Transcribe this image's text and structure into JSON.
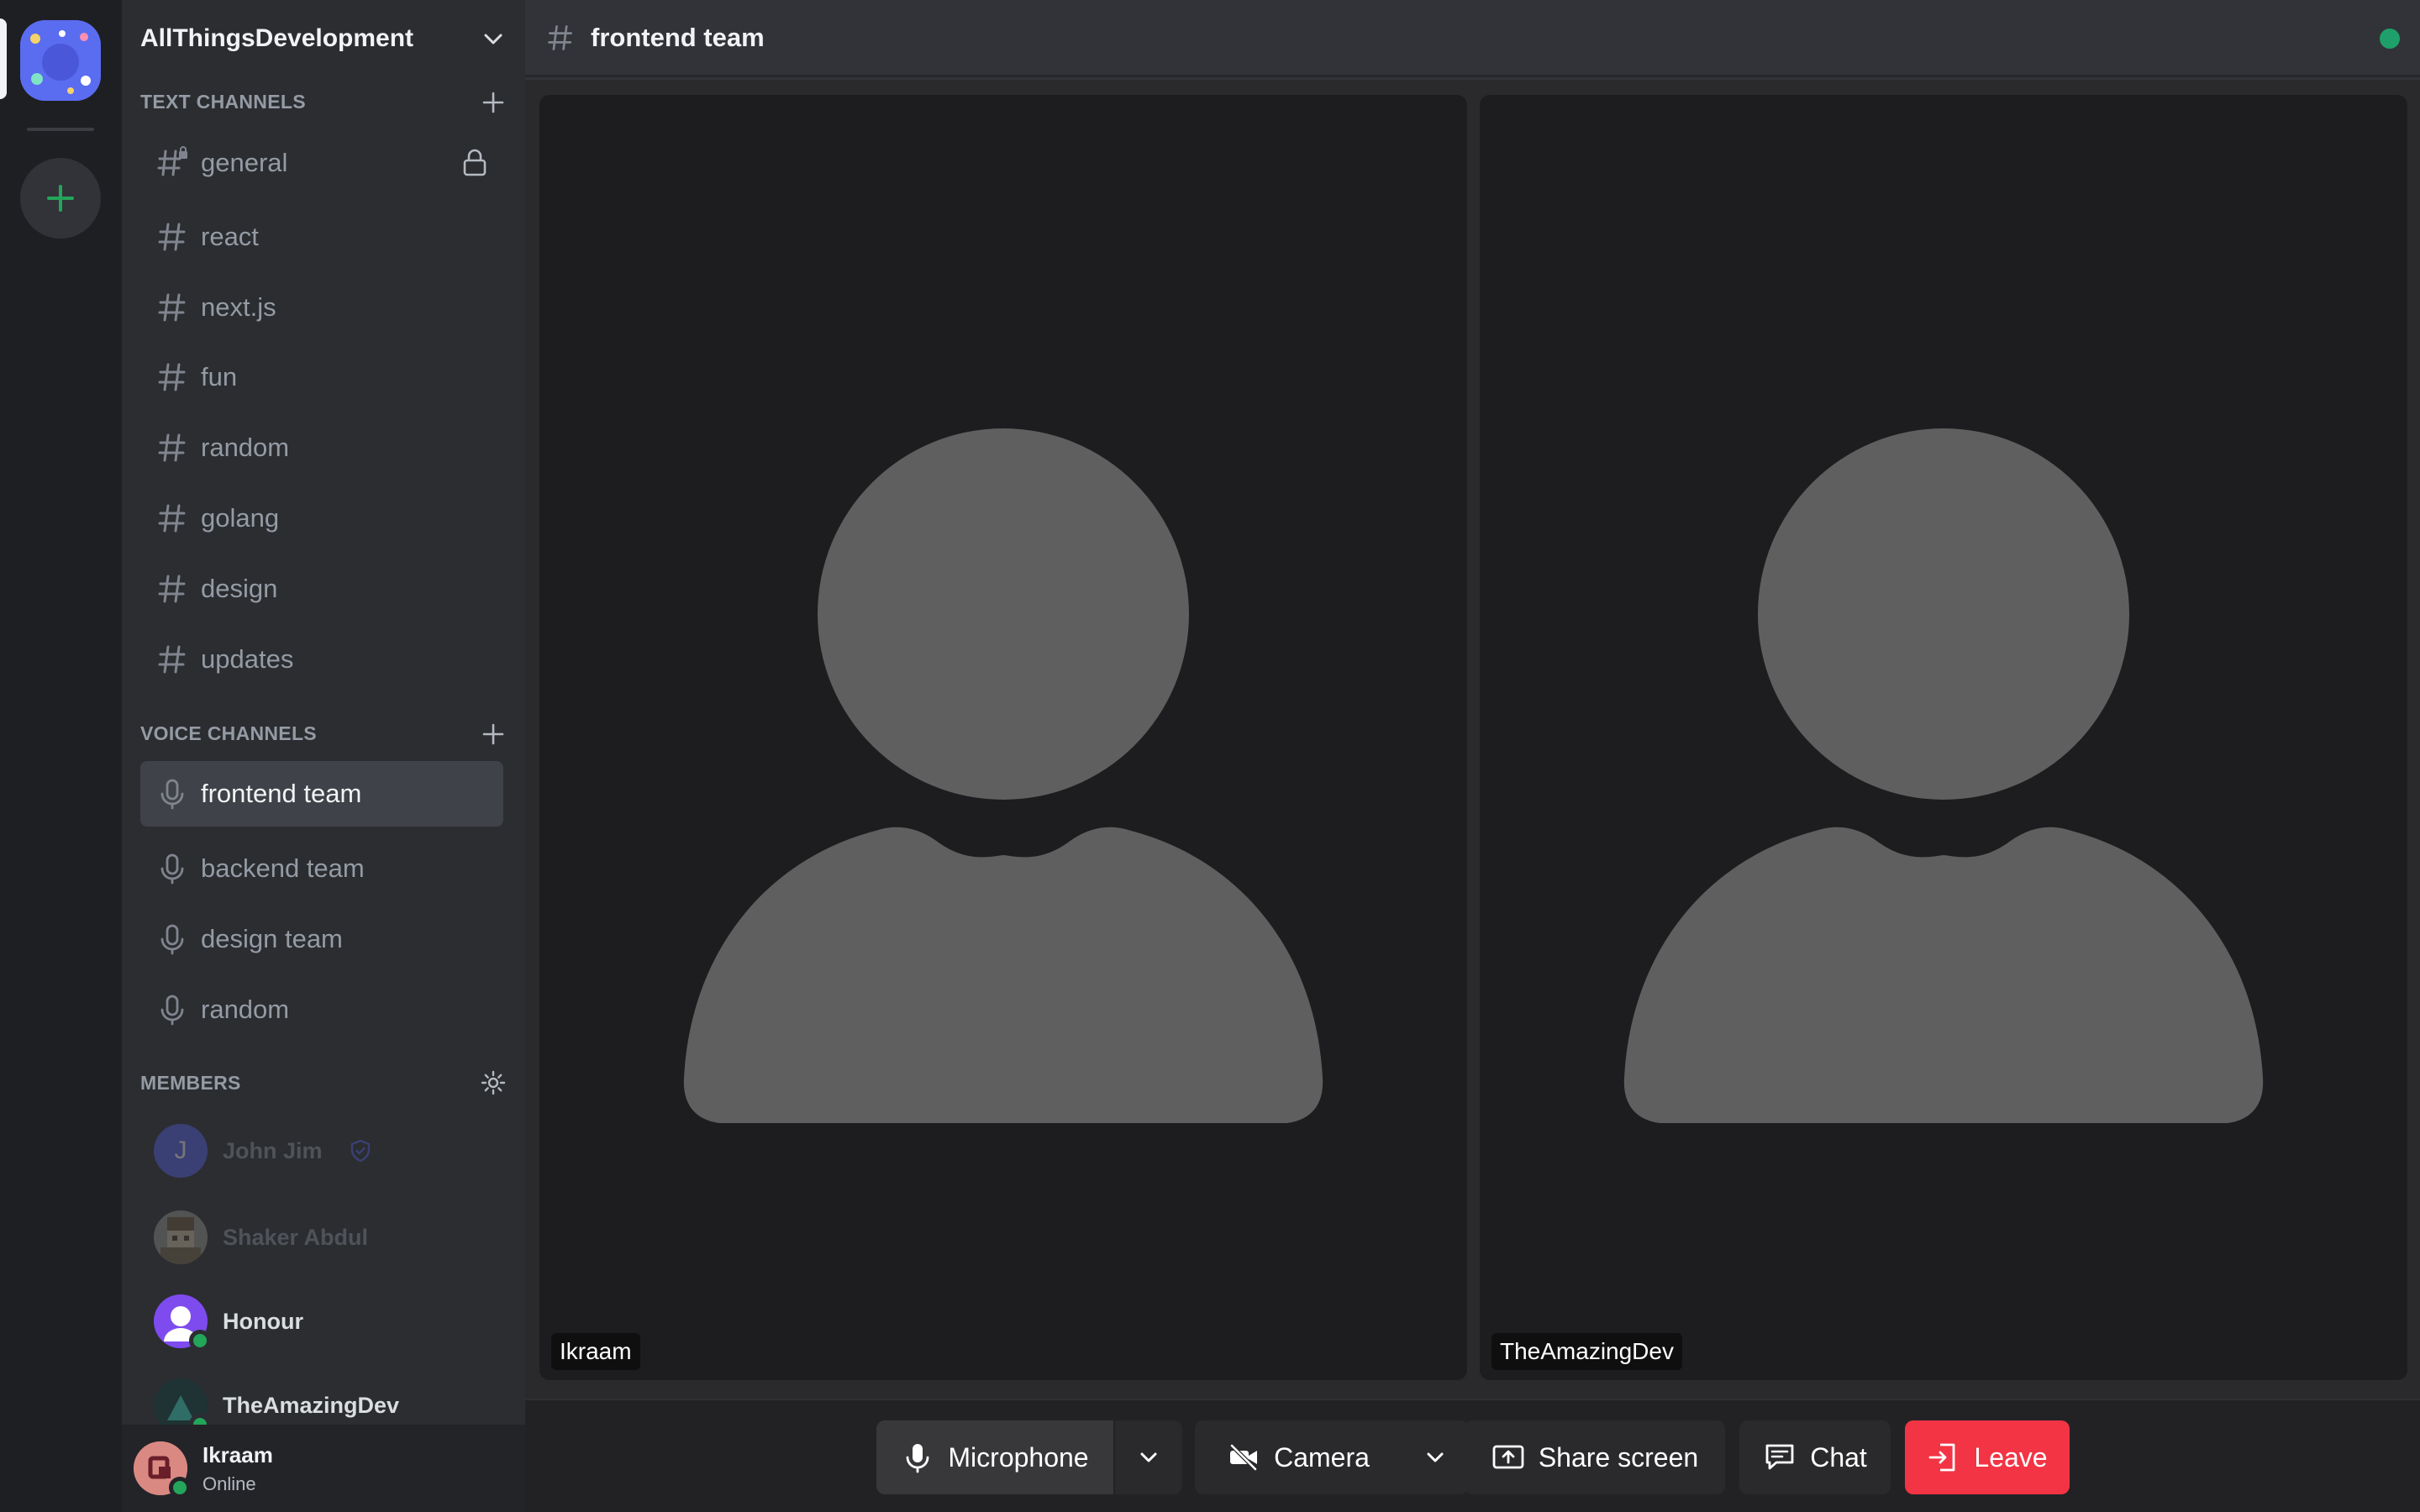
{
  "server": {
    "name": "AllThingsDevelopment"
  },
  "sidebar": {
    "text_header": "TEXT CHANNELS",
    "text_channels": [
      "general",
      "react",
      "next.js",
      "fun",
      "random",
      "golang",
      "design",
      "updates"
    ],
    "voice_header": "VOICE CHANNELS",
    "voice_channels": [
      "frontend team",
      "backend team",
      "design team",
      "random"
    ],
    "active_voice_channel": "frontend team",
    "members_header": "MEMBERS",
    "members": [
      {
        "name": "John Jim",
        "initial": "J",
        "online": false,
        "role_icon": "shield-icon"
      },
      {
        "name": "Shaker Abdul",
        "online": false
      },
      {
        "name": "Honour",
        "online": true
      },
      {
        "name": "TheAmazingDev",
        "online": true
      }
    ]
  },
  "user_panel": {
    "name": "Ikraam",
    "status": "Online"
  },
  "topbar": {
    "channel_name": "frontend team",
    "connection_color": "#1fa06a"
  },
  "participants": [
    {
      "name": "Ikraam"
    },
    {
      "name": "TheAmazingDev"
    }
  ],
  "controls": {
    "microphone": "Microphone",
    "camera": "Camera",
    "share_screen": "Share screen",
    "chat": "Chat",
    "leave": "Leave"
  },
  "colors": {
    "accent_green": "#23a55a",
    "leave_red": "#f23444",
    "active_channel_bg": "#404249"
  }
}
